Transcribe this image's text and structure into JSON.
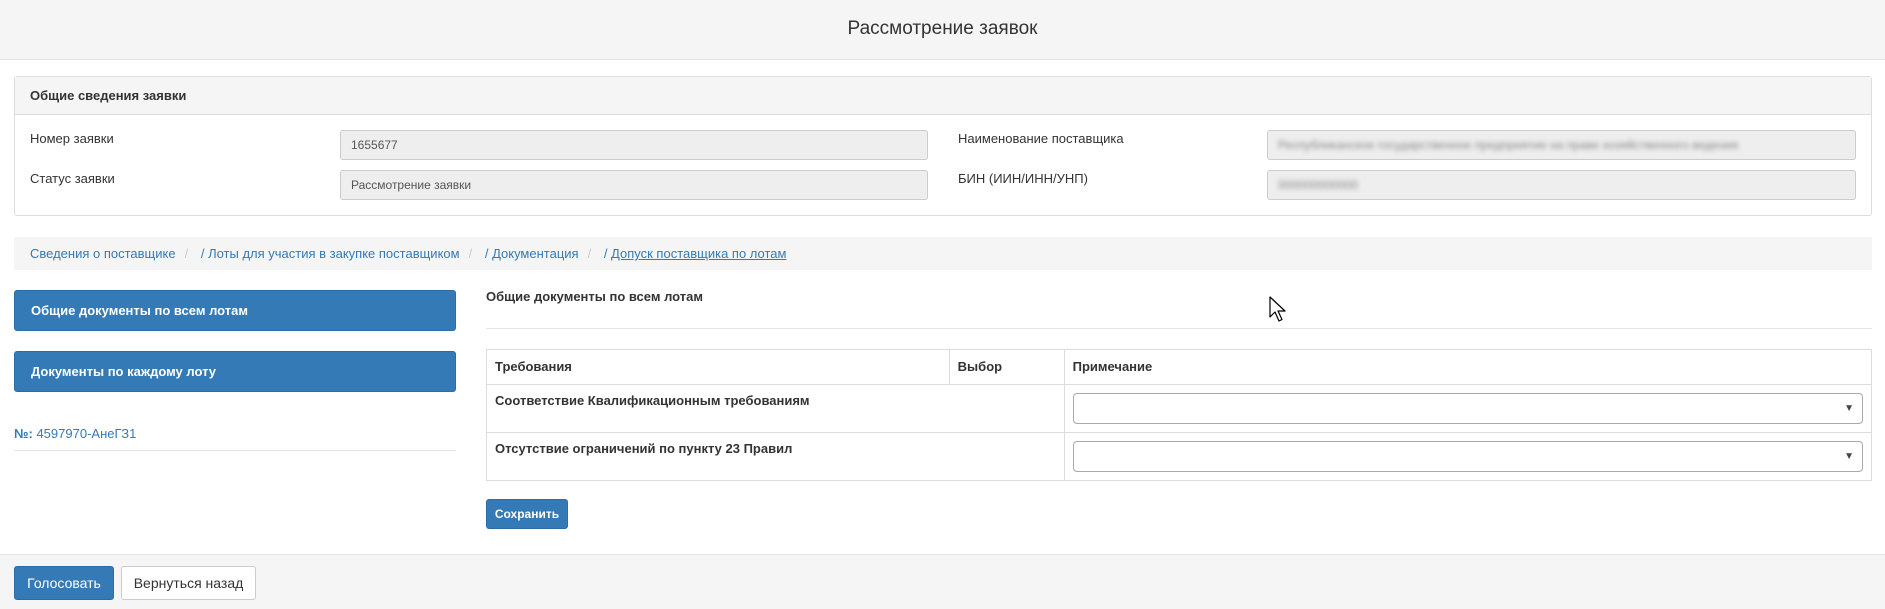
{
  "page": {
    "title": "Рассмотрение заявок"
  },
  "general": {
    "heading": "Общие сведения заявки",
    "app_number_label": "Номер заявки",
    "app_number_value": "1655677",
    "status_label": "Статус заявки",
    "status_value": "Рассмотрение заявки",
    "supplier_name_label": "Наименование поставщика",
    "supplier_name_value": "Республиканское государственное предприятие на праве хозяйственного ведения",
    "bin_label": "БИН (ИИН/ИНН/УНП)",
    "bin_value": "000000000000"
  },
  "breadcrumbs": {
    "items": [
      {
        "label": "Сведения о поставщике"
      },
      {
        "label": "Лоты для участия в закупке поставщиком"
      },
      {
        "label": "Документация"
      },
      {
        "label": "Допуск поставщика по лотам"
      }
    ]
  },
  "sidebar": {
    "common_docs_button": "Общие документы по всем лотам",
    "per_lot_docs_button": "Документы по каждому лоту",
    "lot_prefix": "№:",
    "lot_number": "4597970-АнеГЗ1"
  },
  "main": {
    "section_title": "Общие документы по всем лотам",
    "table": {
      "headers": [
        "Требования",
        "Выбор",
        "Примечание"
      ],
      "rows": [
        {
          "requirement": "Соответствие Квалификационным требованиям",
          "choice": ""
        },
        {
          "requirement": "Отсутствие ограничений по пункту 23 Правил",
          "choice": ""
        }
      ]
    },
    "save_button": "Сохранить"
  },
  "footer": {
    "vote_button": "Голосовать",
    "back_button": "Вернуться назад"
  },
  "colors": {
    "primary": "#337ab7",
    "panel_bg": "#f5f5f5",
    "border": "#dddddd"
  },
  "icons": {
    "dropdown": "chevron-down-icon",
    "pointer": "mouse-cursor-icon"
  }
}
